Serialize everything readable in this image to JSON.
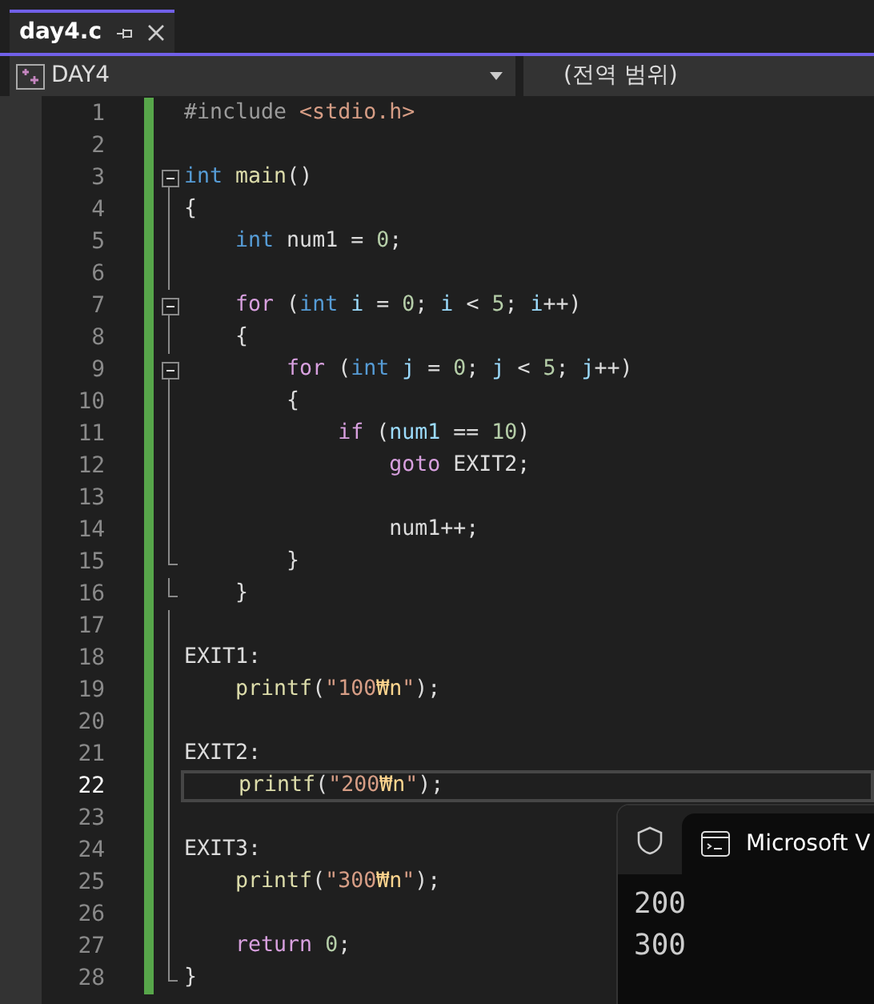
{
  "tab": {
    "title": "day4.c",
    "selected": true
  },
  "nav": {
    "project": "DAY4",
    "scope": "(전역 범위)"
  },
  "lines": [
    {
      "number": "1",
      "kind": "plain",
      "tokens": [
        {
          "text": "#include",
          "kind": "directive"
        },
        {
          "text": " <stdio.h>",
          "kind": "string"
        }
      ]
    },
    {
      "number": "2",
      "kind": "plain"
    },
    {
      "number": "3",
      "kind": "start",
      "tokens": [
        {
          "text": "int",
          "kind": "keyword"
        },
        {
          "text": " main",
          "kind": "function"
        },
        {
          "text": "()",
          "kind": "plain"
        }
      ]
    },
    {
      "number": "4",
      "kind": "body",
      "tokens": [
        {
          "text": "{",
          "kind": "plain"
        }
      ]
    },
    {
      "number": "5",
      "kind": "body",
      "tokens": [
        {
          "text": "    int",
          "kind": "keyword"
        },
        {
          "text": " num1 = ",
          "kind": "plain"
        },
        {
          "text": "0",
          "kind": "number"
        },
        {
          "text": ";",
          "kind": "plain"
        }
      ]
    },
    {
      "number": "6",
      "kind": "body"
    },
    {
      "number": "7",
      "kind": "start",
      "tokens": [
        {
          "text": "    for",
          "kind": "control"
        },
        {
          "text": " (",
          "kind": "plain"
        },
        {
          "text": "int",
          "kind": "keyword"
        },
        {
          "text": " i",
          "kind": "variable"
        },
        {
          "text": " = ",
          "kind": "plain"
        },
        {
          "text": "0",
          "kind": "number"
        },
        {
          "text": "; ",
          "kind": "plain"
        },
        {
          "text": "i",
          "kind": "variable"
        },
        {
          "text": " < ",
          "kind": "plain"
        },
        {
          "text": "5",
          "kind": "number"
        },
        {
          "text": "; ",
          "kind": "plain"
        },
        {
          "text": "i",
          "kind": "variable"
        },
        {
          "text": "++)",
          "kind": "plain"
        }
      ]
    },
    {
      "number": "8",
      "kind": "body",
      "tokens": [
        {
          "text": "    {",
          "kind": "plain"
        }
      ]
    },
    {
      "number": "9",
      "kind": "start",
      "tokens": [
        {
          "text": "        for",
          "kind": "control"
        },
        {
          "text": " (",
          "kind": "plain"
        },
        {
          "text": "int",
          "kind": "keyword"
        },
        {
          "text": " j",
          "kind": "variable"
        },
        {
          "text": " = ",
          "kind": "plain"
        },
        {
          "text": "0",
          "kind": "number"
        },
        {
          "text": "; ",
          "kind": "plain"
        },
        {
          "text": "j",
          "kind": "variable"
        },
        {
          "text": " < ",
          "kind": "plain"
        },
        {
          "text": "5",
          "kind": "number"
        },
        {
          "text": "; ",
          "kind": "plain"
        },
        {
          "text": "j",
          "kind": "variable"
        },
        {
          "text": "++)",
          "kind": "plain"
        }
      ]
    },
    {
      "number": "10",
      "kind": "body",
      "tokens": [
        {
          "text": "        {",
          "kind": "plain"
        }
      ]
    },
    {
      "number": "11",
      "kind": "body",
      "tokens": [
        {
          "text": "            if",
          "kind": "control"
        },
        {
          "text": " (",
          "kind": "plain"
        },
        {
          "text": "num1",
          "kind": "variable"
        },
        {
          "text": " == ",
          "kind": "plain"
        },
        {
          "text": "10",
          "kind": "number"
        },
        {
          "text": ")",
          "kind": "plain"
        }
      ]
    },
    {
      "number": "12",
      "kind": "body",
      "tokens": [
        {
          "text": "                goto",
          "kind": "control"
        },
        {
          "text": " EXIT2;",
          "kind": "plain"
        }
      ]
    },
    {
      "number": "13",
      "kind": "body"
    },
    {
      "number": "14",
      "kind": "body",
      "tokens": [
        {
          "text": "                num1++;",
          "kind": "plain"
        }
      ]
    },
    {
      "number": "15",
      "kind": "end",
      "tokens": [
        {
          "text": "        }",
          "kind": "plain"
        }
      ]
    },
    {
      "number": "16",
      "kind": "end",
      "tokens": [
        {
          "text": "    }",
          "kind": "plain"
        }
      ]
    },
    {
      "number": "17",
      "kind": "body"
    },
    {
      "number": "18",
      "kind": "body",
      "tokens": [
        {
          "text": "EXIT1:",
          "kind": "plain"
        }
      ]
    },
    {
      "number": "19",
      "kind": "body",
      "tokens": [
        {
          "text": "    printf",
          "kind": "function"
        },
        {
          "text": "(",
          "kind": "plain"
        },
        {
          "text": "\"100",
          "kind": "string"
        },
        {
          "text": "₩n",
          "kind": "escape"
        },
        {
          "text": "\"",
          "kind": "string"
        },
        {
          "text": ");",
          "kind": "plain"
        }
      ]
    },
    {
      "number": "20",
      "kind": "body"
    },
    {
      "number": "21",
      "kind": "body",
      "tokens": [
        {
          "text": "EXIT2:",
          "kind": "plain"
        }
      ]
    },
    {
      "number": "22",
      "kind": "body",
      "current": true,
      "tokens": [
        {
          "text": "    printf",
          "kind": "function"
        },
        {
          "text": "(",
          "kind": "plain"
        },
        {
          "text": "\"200",
          "kind": "string"
        },
        {
          "text": "₩n",
          "kind": "escape"
        },
        {
          "text": "\"",
          "kind": "string"
        },
        {
          "text": ");",
          "kind": "plain"
        }
      ]
    },
    {
      "number": "23",
      "kind": "body"
    },
    {
      "number": "24",
      "kind": "body",
      "tokens": [
        {
          "text": "EXIT3:",
          "kind": "plain"
        }
      ]
    },
    {
      "number": "25",
      "kind": "body",
      "tokens": [
        {
          "text": "    printf",
          "kind": "function"
        },
        {
          "text": "(",
          "kind": "plain"
        },
        {
          "text": "\"300",
          "kind": "string"
        },
        {
          "text": "₩n",
          "kind": "escape"
        },
        {
          "text": "\"",
          "kind": "string"
        },
        {
          "text": ");",
          "kind": "plain"
        }
      ]
    },
    {
      "number": "26",
      "kind": "body"
    },
    {
      "number": "27",
      "kind": "body",
      "tokens": [
        {
          "text": "    return",
          "kind": "control"
        },
        {
          "text": " 0",
          "kind": "number"
        },
        {
          "text": ";",
          "kind": "plain"
        }
      ]
    },
    {
      "number": "28",
      "kind": "end",
      "tokens": [
        {
          "text": "}",
          "kind": "plain"
        }
      ]
    }
  ],
  "console": {
    "title": "Microsoft V",
    "output": [
      "200",
      "300"
    ]
  }
}
